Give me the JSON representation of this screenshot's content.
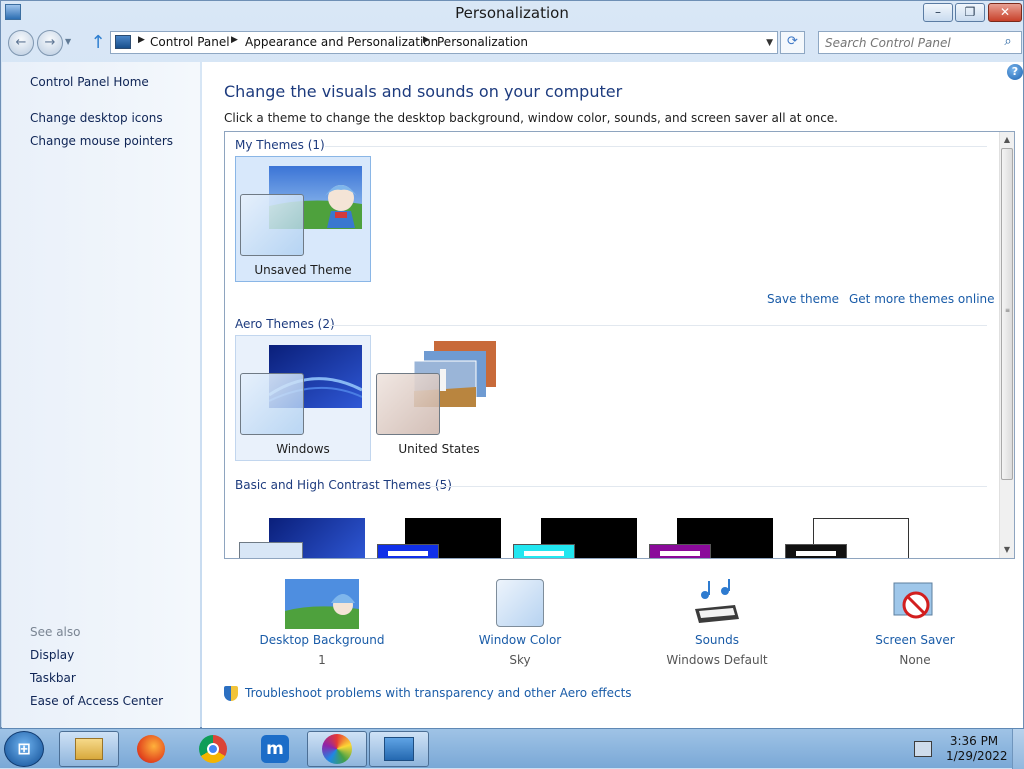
{
  "window": {
    "title": "Personalization",
    "minimize_glyph": "–",
    "maximize_glyph": "❐",
    "close_glyph": "✕"
  },
  "nav": {
    "back_glyph": "←",
    "forward_glyph": "→",
    "up_glyph": "↑",
    "breadcrumbs": [
      "Control Panel",
      "Appearance and Personalization",
      "Personalization"
    ],
    "search_placeholder": "Search Control Panel"
  },
  "sidebar": {
    "home": "Control Panel Home",
    "tasks": [
      "Change desktop icons",
      "Change mouse pointers"
    ],
    "see_also_label": "See also",
    "see_also": [
      "Display",
      "Taskbar",
      "Ease of Access Center"
    ]
  },
  "main": {
    "heading": "Change the visuals and sounds on your computer",
    "subtitle": "Click a theme to change the desktop background, window color, sounds, and screen saver all at once.",
    "sections": {
      "my_themes": "My Themes (1)",
      "aero_themes": "Aero Themes (2)",
      "basic_themes": "Basic and High Contrast Themes (5)"
    },
    "my_themes": [
      {
        "label": "Unsaved Theme",
        "selected": true
      }
    ],
    "save_theme": "Save theme",
    "get_more": "Get more themes online",
    "aero_themes": [
      {
        "label": "Windows"
      },
      {
        "label": "United States"
      }
    ],
    "basic_colors": [
      "#1030e8",
      "#22e6f0",
      "#8a0a9a",
      "#111111"
    ],
    "settings": [
      {
        "link": "Desktop Background",
        "value": "1",
        "icon": "desktop-background-icon"
      },
      {
        "link": "Window Color",
        "value": "Sky",
        "icon": "window-color-icon"
      },
      {
        "link": "Sounds",
        "value": "Windows Default",
        "icon": "sounds-icon"
      },
      {
        "link": "Screen Saver",
        "value": "None",
        "icon": "screen-saver-icon"
      }
    ],
    "troubleshoot": "Troubleshoot problems with transparency and other Aero effects"
  },
  "taskbar": {
    "start_glyph": "⊞",
    "apps": [
      "file-explorer-icon",
      "firefox-icon",
      "chrome-icon",
      "maxthon-icon",
      "color-wheel-icon",
      "control-panel-icon"
    ],
    "time": "3:36 PM",
    "date": "1/29/2022"
  },
  "colors": {
    "link": "#1a5ca8",
    "heading": "#1d3b7e",
    "sidebar_text": "#0e2455"
  }
}
